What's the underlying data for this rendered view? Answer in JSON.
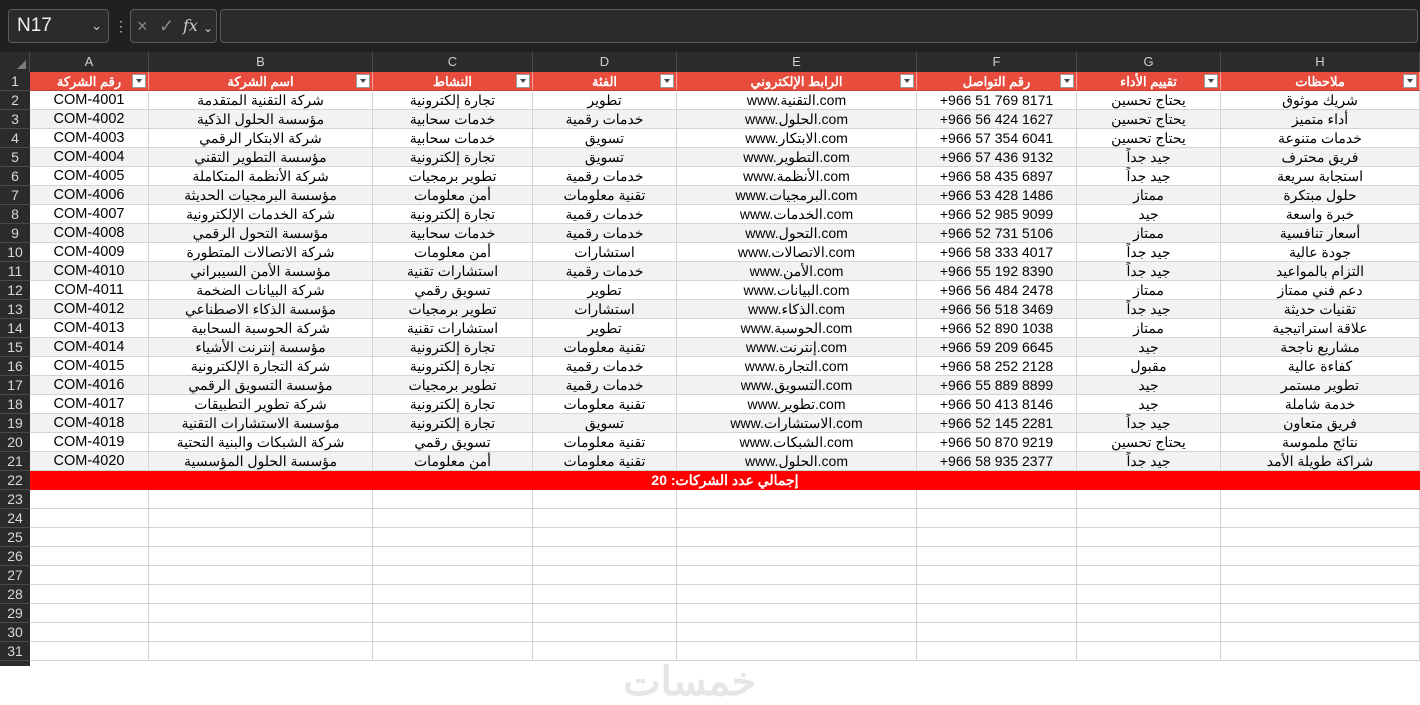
{
  "formula_bar": {
    "name_box": "N17",
    "cancel_icon": "×",
    "enter_icon": "✓",
    "fx_label": "fx",
    "formula": ""
  },
  "columns": [
    "A",
    "B",
    "C",
    "D",
    "E",
    "F",
    "G",
    "H"
  ],
  "row_numbers": [
    "1",
    "2",
    "3",
    "4",
    "5",
    "6",
    "7",
    "8",
    "9",
    "10",
    "11",
    "12",
    "13",
    "14",
    "15",
    "16",
    "17",
    "18",
    "19",
    "20",
    "21",
    "22",
    "23",
    "24",
    "25",
    "26",
    "27",
    "28",
    "29",
    "30",
    "31"
  ],
  "headers": [
    "رقم الشركة",
    "اسم الشركة",
    "النشاط",
    "الفئة",
    "الرابط الإلكتروني",
    "رقم التواصل",
    "تقييم الأداء",
    "ملاحظات"
  ],
  "rows": [
    [
      "COM-4001",
      "شركة التقنية المتقدمة",
      "تجارة إلكترونية",
      "تطوير",
      "www.التقنية.com",
      "+966 51 769 8171",
      "يحتاج تحسين",
      "شريك موثوق"
    ],
    [
      "COM-4002",
      "مؤسسة الحلول الذكية",
      "خدمات سحابية",
      "خدمات رقمية",
      "www.الحلول.com",
      "+966 56 424 1627",
      "يحتاج تحسين",
      "أداء متميز"
    ],
    [
      "COM-4003",
      "شركة الابتكار الرقمي",
      "خدمات سحابية",
      "تسويق",
      "www.الابتكار.com",
      "+966 57 354 6041",
      "يحتاج تحسين",
      "خدمات متنوعة"
    ],
    [
      "COM-4004",
      "مؤسسة التطوير التقني",
      "تجارة إلكترونية",
      "تسويق",
      "www.التطوير.com",
      "+966 57 436 9132",
      "جيد جداً",
      "فريق محترف"
    ],
    [
      "COM-4005",
      "شركة الأنظمة المتكاملة",
      "تطوير برمجيات",
      "خدمات رقمية",
      "www.الأنظمة.com",
      "+966 58 435 6897",
      "جيد جداً",
      "استجابة سريعة"
    ],
    [
      "COM-4006",
      "مؤسسة البرمجيات الحديثة",
      "أمن معلومات",
      "تقنية معلومات",
      "www.البرمجيات.com",
      "+966 53 428 1486",
      "ممتاز",
      "حلول مبتكرة"
    ],
    [
      "COM-4007",
      "شركة الخدمات الإلكترونية",
      "تجارة إلكترونية",
      "خدمات رقمية",
      "www.الخدمات.com",
      "+966 52 985 9099",
      "جيد",
      "خبرة واسعة"
    ],
    [
      "COM-4008",
      "مؤسسة التحول الرقمي",
      "خدمات سحابية",
      "خدمات رقمية",
      "www.التحول.com",
      "+966 52 731 5106",
      "ممتاز",
      "أسعار تنافسية"
    ],
    [
      "COM-4009",
      "شركة الاتصالات المتطورة",
      "أمن معلومات",
      "استشارات",
      "www.الاتصالات.com",
      "+966 58 333 4017",
      "جيد جداً",
      "جودة عالية"
    ],
    [
      "COM-4010",
      "مؤسسة الأمن السيبراني",
      "استشارات تقنية",
      "خدمات رقمية",
      "www.الأمن.com",
      "+966 55 192 8390",
      "جيد جداً",
      "التزام بالمواعيد"
    ],
    [
      "COM-4011",
      "شركة البيانات الضخمة",
      "تسويق رقمي",
      "تطوير",
      "www.البيانات.com",
      "+966 56 484 2478",
      "ممتاز",
      "دعم فني ممتاز"
    ],
    [
      "COM-4012",
      "مؤسسة الذكاء الاصطناعي",
      "تطوير برمجيات",
      "استشارات",
      "www.الذكاء.com",
      "+966 56 518 3469",
      "جيد جداً",
      "تقنيات حديثة"
    ],
    [
      "COM-4013",
      "شركة الحوسبة السحابية",
      "استشارات تقنية",
      "تطوير",
      "www.الحوسبة.com",
      "+966 52 890 1038",
      "ممتاز",
      "علاقة استراتيجية"
    ],
    [
      "COM-4014",
      "مؤسسة إنترنت الأشياء",
      "تجارة إلكترونية",
      "تقنية معلومات",
      "www.إنترنت.com",
      "+966 59 209 6645",
      "جيد",
      "مشاريع ناجحة"
    ],
    [
      "COM-4015",
      "شركة التجارة الإلكترونية",
      "تجارة إلكترونية",
      "خدمات رقمية",
      "www.التجارة.com",
      "+966 58 252 2128",
      "مقبول",
      "كفاءة عالية"
    ],
    [
      "COM-4016",
      "مؤسسة التسويق الرقمي",
      "تطوير برمجيات",
      "خدمات رقمية",
      "www.التسويق.com",
      "+966 55 889 8899",
      "جيد",
      "تطوير مستمر"
    ],
    [
      "COM-4017",
      "شركة تطوير التطبيقات",
      "تجارة إلكترونية",
      "تقنية معلومات",
      "www.تطوير.com",
      "+966 50 413 8146",
      "جيد",
      "خدمة شاملة"
    ],
    [
      "COM-4018",
      "مؤسسة الاستشارات التقنية",
      "تجارة إلكترونية",
      "تسويق",
      "www.الاستشارات.com",
      "+966 52 145 2281",
      "جيد جداً",
      "فريق متعاون"
    ],
    [
      "COM-4019",
      "شركة الشبكات والبنية التحتية",
      "تسويق رقمي",
      "تقنية معلومات",
      "www.الشبكات.com",
      "+966 50 870 9219",
      "يحتاج تحسين",
      "نتائج ملموسة"
    ],
    [
      "COM-4020",
      "مؤسسة الحلول المؤسسية",
      "أمن معلومات",
      "تقنية معلومات",
      "www.الحلول.com",
      "+966 58 935 2377",
      "جيد جداً",
      "شراكة طويلة الأمد"
    ]
  ],
  "total_label": "إجمالي عدد الشركات: 20",
  "watermark": "خمسات",
  "colors": {
    "header_bg": "#e84c3d",
    "total_bg": "#ff0000",
    "alt_row": "#f2f2f2",
    "chrome": "#202020"
  }
}
